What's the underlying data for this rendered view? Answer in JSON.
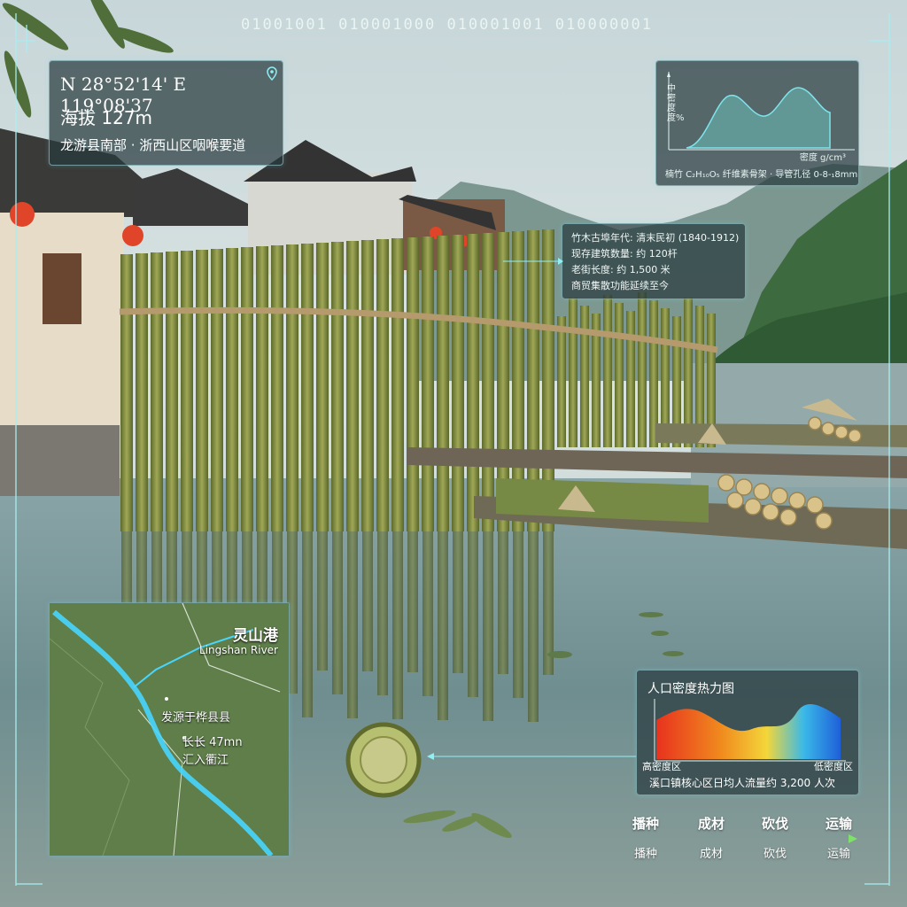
{
  "header": {
    "binary": "01001001  010001000  010001001  010000001"
  },
  "coordinates": {
    "latlon": "N 28°52'14' E 119°08'37",
    "altitude": "海拔 127m",
    "location": "龙游县南部 · 浙西山区咽喉要道"
  },
  "density_chart": {
    "ylabel": "中密度度%",
    "xlabel": "密度 g/cm³",
    "footnote": "楠竹 C₂H₁₀O₅ 纤维素骨架 · 导管孔径 0-8-₁8mm"
  },
  "stats": {
    "l1": "竹木古埠年代: 清末民初 (1840-1912)",
    "l2": "现存建筑数量: 约 120杆",
    "l3": "老街长度: 约 1,500 米",
    "l4": "商贸集散功能延续至今"
  },
  "heatmap": {
    "title": "人口密度热力图",
    "low_label": "高密度区",
    "high_label": "低密度区",
    "note": "溪口镇核心区日均人流量约 3,200 人次"
  },
  "map": {
    "name_cn": "灵山港",
    "name_en": "Lingshan River",
    "source": "发源于桦县县",
    "length": "长长 47mn",
    "confluence": "汇入衢江"
  },
  "process": {
    "steps_top": [
      "播种",
      "成材",
      "砍伐",
      "运输"
    ],
    "steps_bottom": [
      "播种",
      "成材",
      "砍伐",
      "运输"
    ]
  },
  "colors": {
    "accent": "#7fe3ec",
    "panel": "#283a3e",
    "bamboo": "#7f8a3e",
    "water": "#7a9a9e"
  }
}
